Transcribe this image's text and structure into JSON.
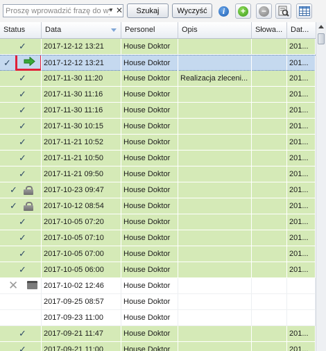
{
  "toolbar": {
    "search_placeholder": "Proszę wprowadzić frazę do wyszukania",
    "search_button": "Szukaj",
    "clear_button": "Wyczyść",
    "icons": [
      "info-icon",
      "add-icon",
      "remove-icon",
      "filter-settings-icon",
      "table-view-icon"
    ]
  },
  "table": {
    "columns": [
      "Status",
      "Data",
      "Personel",
      "Opis",
      "Słowa...",
      "Dat..."
    ],
    "sorted_column": "Data",
    "rows": [
      {
        "status": "check",
        "data": "2017-12-12 13:21",
        "personel": "House Doktor",
        "opis": "",
        "dat": "201..."
      },
      {
        "status": "check-arrow",
        "data": "2017-12-12 13:21",
        "personel": "House Doktor",
        "opis": "",
        "dat": "201..."
      },
      {
        "status": "check",
        "data": "2017-11-30 11:20",
        "personel": "House Doktor",
        "opis": "Realizacja zleceni...",
        "dat": "201..."
      },
      {
        "status": "check",
        "data": "2017-11-30 11:16",
        "personel": "House Doktor",
        "opis": "",
        "dat": "201..."
      },
      {
        "status": "check",
        "data": "2017-11-30 11:16",
        "personel": "House Doktor",
        "opis": "",
        "dat": "201..."
      },
      {
        "status": "check",
        "data": "2017-11-30 10:15",
        "personel": "House Doktor",
        "opis": "",
        "dat": "201..."
      },
      {
        "status": "check",
        "data": "2017-11-21 10:52",
        "personel": "House Doktor",
        "opis": "",
        "dat": "201..."
      },
      {
        "status": "check",
        "data": "2017-11-21 10:50",
        "personel": "House Doktor",
        "opis": "",
        "dat": "201..."
      },
      {
        "status": "check",
        "data": "2017-11-21 09:50",
        "personel": "House Doktor",
        "opis": "",
        "dat": "201..."
      },
      {
        "status": "check-lock",
        "data": "2017-10-23 09:47",
        "personel": "House Doktor",
        "opis": "",
        "dat": "201..."
      },
      {
        "status": "check-lock",
        "data": "2017-10-12 08:54",
        "personel": "House Doktor",
        "opis": "",
        "dat": "201..."
      },
      {
        "status": "check",
        "data": "2017-10-05 07:20",
        "personel": "House Doktor",
        "opis": "",
        "dat": "201..."
      },
      {
        "status": "check",
        "data": "2017-10-05 07:10",
        "personel": "House Doktor",
        "opis": "",
        "dat": "201..."
      },
      {
        "status": "check",
        "data": "2017-10-05 07:00",
        "personel": "House Doktor",
        "opis": "",
        "dat": "201..."
      },
      {
        "status": "check",
        "data": "2017-10-05 06:00",
        "personel": "House Doktor",
        "opis": "",
        "dat": "201..."
      },
      {
        "status": "x-calendar",
        "data": "2017-10-02 12:46",
        "personel": "House Doktor",
        "opis": "",
        "dat": ""
      },
      {
        "status": "none",
        "data": "2017-09-25 08:57",
        "personel": "House Doktor",
        "opis": "",
        "dat": ""
      },
      {
        "status": "none",
        "data": "2017-09-23 11:00",
        "personel": "House Doktor",
        "opis": "",
        "dat": ""
      },
      {
        "status": "check",
        "data": "2017-09-21 11:47",
        "personel": "House Doktor",
        "opis": "",
        "dat": "201..."
      },
      {
        "status": "check",
        "data": "2017-09-21 11:00",
        "personel": "House Doktor",
        "opis": "",
        "dat": "201..."
      }
    ]
  },
  "colors": {
    "row_green": "#d5eab7",
    "row_selected": "#c5d9ef",
    "highlight_box": "#e0203a",
    "arrow_green": "#3aa83a"
  }
}
